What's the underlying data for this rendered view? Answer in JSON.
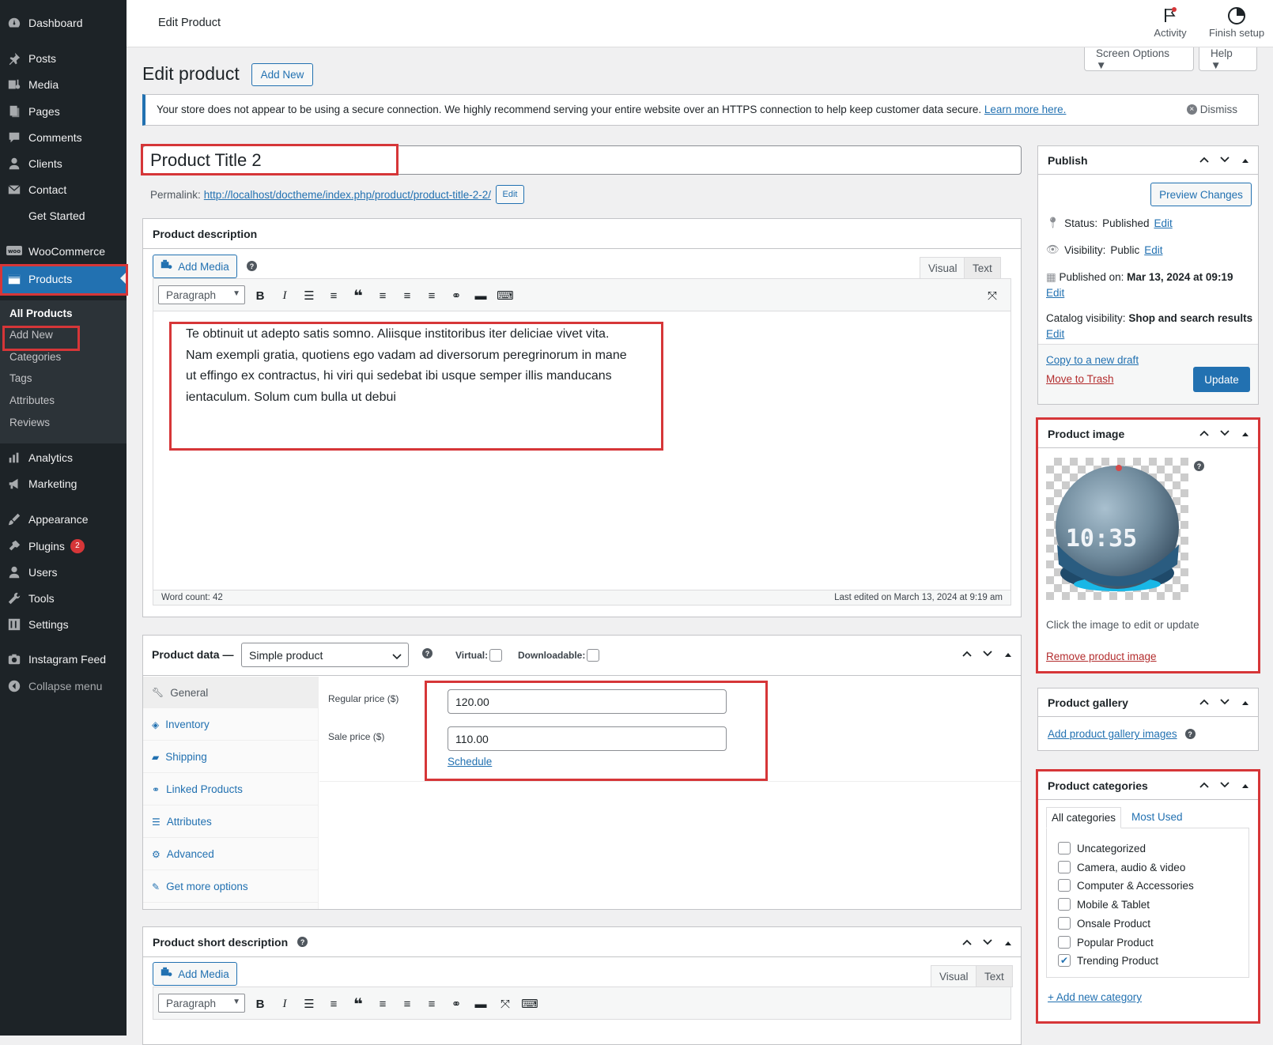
{
  "sidebar": {
    "items": [
      {
        "label": "Dashboard",
        "icon": "dashboard-icon"
      },
      {
        "label": "Posts",
        "icon": "pin-icon"
      },
      {
        "label": "Media",
        "icon": "media-icon"
      },
      {
        "label": "Pages",
        "icon": "pages-icon"
      },
      {
        "label": "Comments",
        "icon": "comment-icon"
      },
      {
        "label": "Clients",
        "icon": "user-icon"
      },
      {
        "label": "Contact",
        "icon": "mail-icon"
      },
      {
        "label": "Get Started",
        "icon": ""
      },
      {
        "label": "WooCommerce",
        "icon": "woo-icon"
      },
      {
        "label": "Products",
        "icon": "products-icon"
      },
      {
        "label": "Analytics",
        "icon": "chart-icon"
      },
      {
        "label": "Marketing",
        "icon": "megaphone-icon"
      },
      {
        "label": "Appearance",
        "icon": "brush-icon"
      },
      {
        "label": "Plugins",
        "icon": "plugin-icon"
      },
      {
        "label": "Users",
        "icon": "users-icon"
      },
      {
        "label": "Tools",
        "icon": "wrench-icon"
      },
      {
        "label": "Settings",
        "icon": "settings-icon"
      },
      {
        "label": "Instagram Feed",
        "icon": "camera-icon"
      },
      {
        "label": "Collapse menu",
        "icon": "collapse-icon"
      }
    ],
    "plugins_badge": "2",
    "submenu": [
      "All Products",
      "Add New",
      "Categories",
      "Tags",
      "Attributes",
      "Reviews"
    ]
  },
  "topbar": {
    "title": "Edit Product",
    "activity": "Activity",
    "finish_setup": "Finish setup"
  },
  "screen_options": "Screen Options ▼",
  "help_tab": "Help ▼",
  "heading": {
    "title": "Edit product",
    "add_new": "Add New"
  },
  "notice": {
    "text": "Your store does not appear to be using a secure connection. We highly recommend serving your entire website over an HTTPS connection to help keep customer data secure.",
    "link": "Learn more here.",
    "dismiss": "Dismiss"
  },
  "title_field": {
    "value": "Product Title 2"
  },
  "permalink": {
    "label": "Permalink:",
    "url": "http://localhost/doctheme/index.php/product/product-title-2-2/",
    "edit": "Edit"
  },
  "description": {
    "title": "Product description",
    "add_media": "Add Media",
    "tab_visual": "Visual",
    "tab_text": "Text",
    "format": "Paragraph",
    "content": "Te obtinuit ut adepto satis somno. Aliisque institoribus iter deliciae vivet vita. Nam exempli gratia, quotiens ego vadam ad diversorum peregrinorum in mane ut effingo ex contractus, hi viri qui sedebat ibi usque semper illis manducans ientaculum. Solum cum bulla ut debui",
    "word_count": "Word count: 42",
    "last_edited": "Last edited on March 13, 2024 at 9:19 am"
  },
  "product_data": {
    "label": "Product data —",
    "type": "Simple product",
    "virtual": "Virtual:",
    "downloadable": "Downloadable:",
    "tabs": [
      "General",
      "Inventory",
      "Shipping",
      "Linked Products",
      "Attributes",
      "Advanced",
      "Get more options"
    ],
    "regular_price_label": "Regular price ($)",
    "regular_price": "120.00",
    "sale_price_label": "Sale price ($)",
    "sale_price": "110.00",
    "schedule": "Schedule"
  },
  "short_description": {
    "title": "Product short description",
    "add_media": "Add Media",
    "tab_visual": "Visual",
    "tab_text": "Text",
    "format": "Paragraph"
  },
  "publish": {
    "title": "Publish",
    "preview": "Preview Changes",
    "status_label": "Status:",
    "status_value": "Published",
    "visibility_label": "Visibility:",
    "visibility_value": "Public",
    "published_label": "Published on:",
    "published_value": "Mar 13, 2024 at 09:19",
    "catalog_label": "Catalog visibility:",
    "catalog_value": "Shop and search results",
    "edit": "Edit",
    "copy_draft": "Copy to a new draft",
    "trash": "Move to Trash",
    "update": "Update"
  },
  "product_image": {
    "title": "Product image",
    "hint": "Click the image to edit or update",
    "remove": "Remove product image",
    "clock_text": "10:35"
  },
  "gallery": {
    "title": "Product gallery",
    "add": "Add product gallery images"
  },
  "categories": {
    "title": "Product categories",
    "tab_all": "All categories",
    "tab_used": "Most Used",
    "items": [
      {
        "label": "Uncategorized",
        "checked": false
      },
      {
        "label": "Camera, audio & video",
        "checked": false
      },
      {
        "label": "Computer & Accessories",
        "checked": false
      },
      {
        "label": "Mobile & Tablet",
        "checked": false
      },
      {
        "label": "Onsale Product",
        "checked": false
      },
      {
        "label": "Popular Product",
        "checked": false
      },
      {
        "label": "Trending Product",
        "checked": true
      }
    ],
    "add_new": "+ Add new category"
  },
  "colors": {
    "accent": "#2271b1",
    "highlight": "#d63638",
    "sidebar": "#1d2327"
  }
}
